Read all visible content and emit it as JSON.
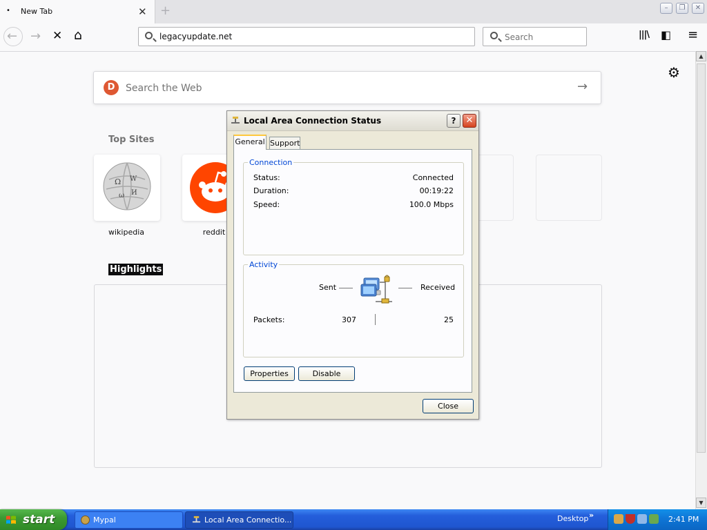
{
  "browser": {
    "tab": {
      "title": "New Tab",
      "close": "✕"
    },
    "new_tab": "+",
    "window_buttons": {
      "minimize": "–",
      "restore": "❐",
      "close": "✕"
    },
    "nav": {
      "back": "←",
      "forward": "→",
      "stop": "✕",
      "home": "⌂"
    },
    "url": "legacyupdate.net",
    "search_placeholder": "Search",
    "toolbar": {
      "library": "|||\\",
      "sidebar": "◧",
      "menu": "≡"
    }
  },
  "newtab": {
    "web_search_placeholder": "Search the Web",
    "web_search_arrow": "→",
    "settings": "⚙",
    "top_sites_title": "Top Sites",
    "top_sites": [
      {
        "label": "wikipedia"
      },
      {
        "label": "reddit"
      }
    ],
    "highlights_title": "Highlights"
  },
  "dialog": {
    "title": "Local Area Connection Status",
    "help": "?",
    "close_x": "✕",
    "tabs": [
      "General",
      "Support"
    ],
    "connection": {
      "group_label": "Connection",
      "status_label": "Status:",
      "status_value": "Connected",
      "duration_label": "Duration:",
      "duration_value": "00:19:22",
      "speed_label": "Speed:",
      "speed_value": "100.0 Mbps"
    },
    "activity": {
      "group_label": "Activity",
      "sent_label": "Sent",
      "received_label": "Received",
      "packets_label": "Packets:",
      "packets_sent": "307",
      "packets_received": "25"
    },
    "buttons": {
      "properties": "Properties",
      "disable": "Disable",
      "close": "Close"
    }
  },
  "taskbar": {
    "start": "start",
    "items": [
      {
        "label": "Mypal"
      },
      {
        "label": "Local Area Connectio..."
      }
    ],
    "desktop": "Desktop",
    "chevron": "»",
    "clock": "2:41 PM"
  }
}
